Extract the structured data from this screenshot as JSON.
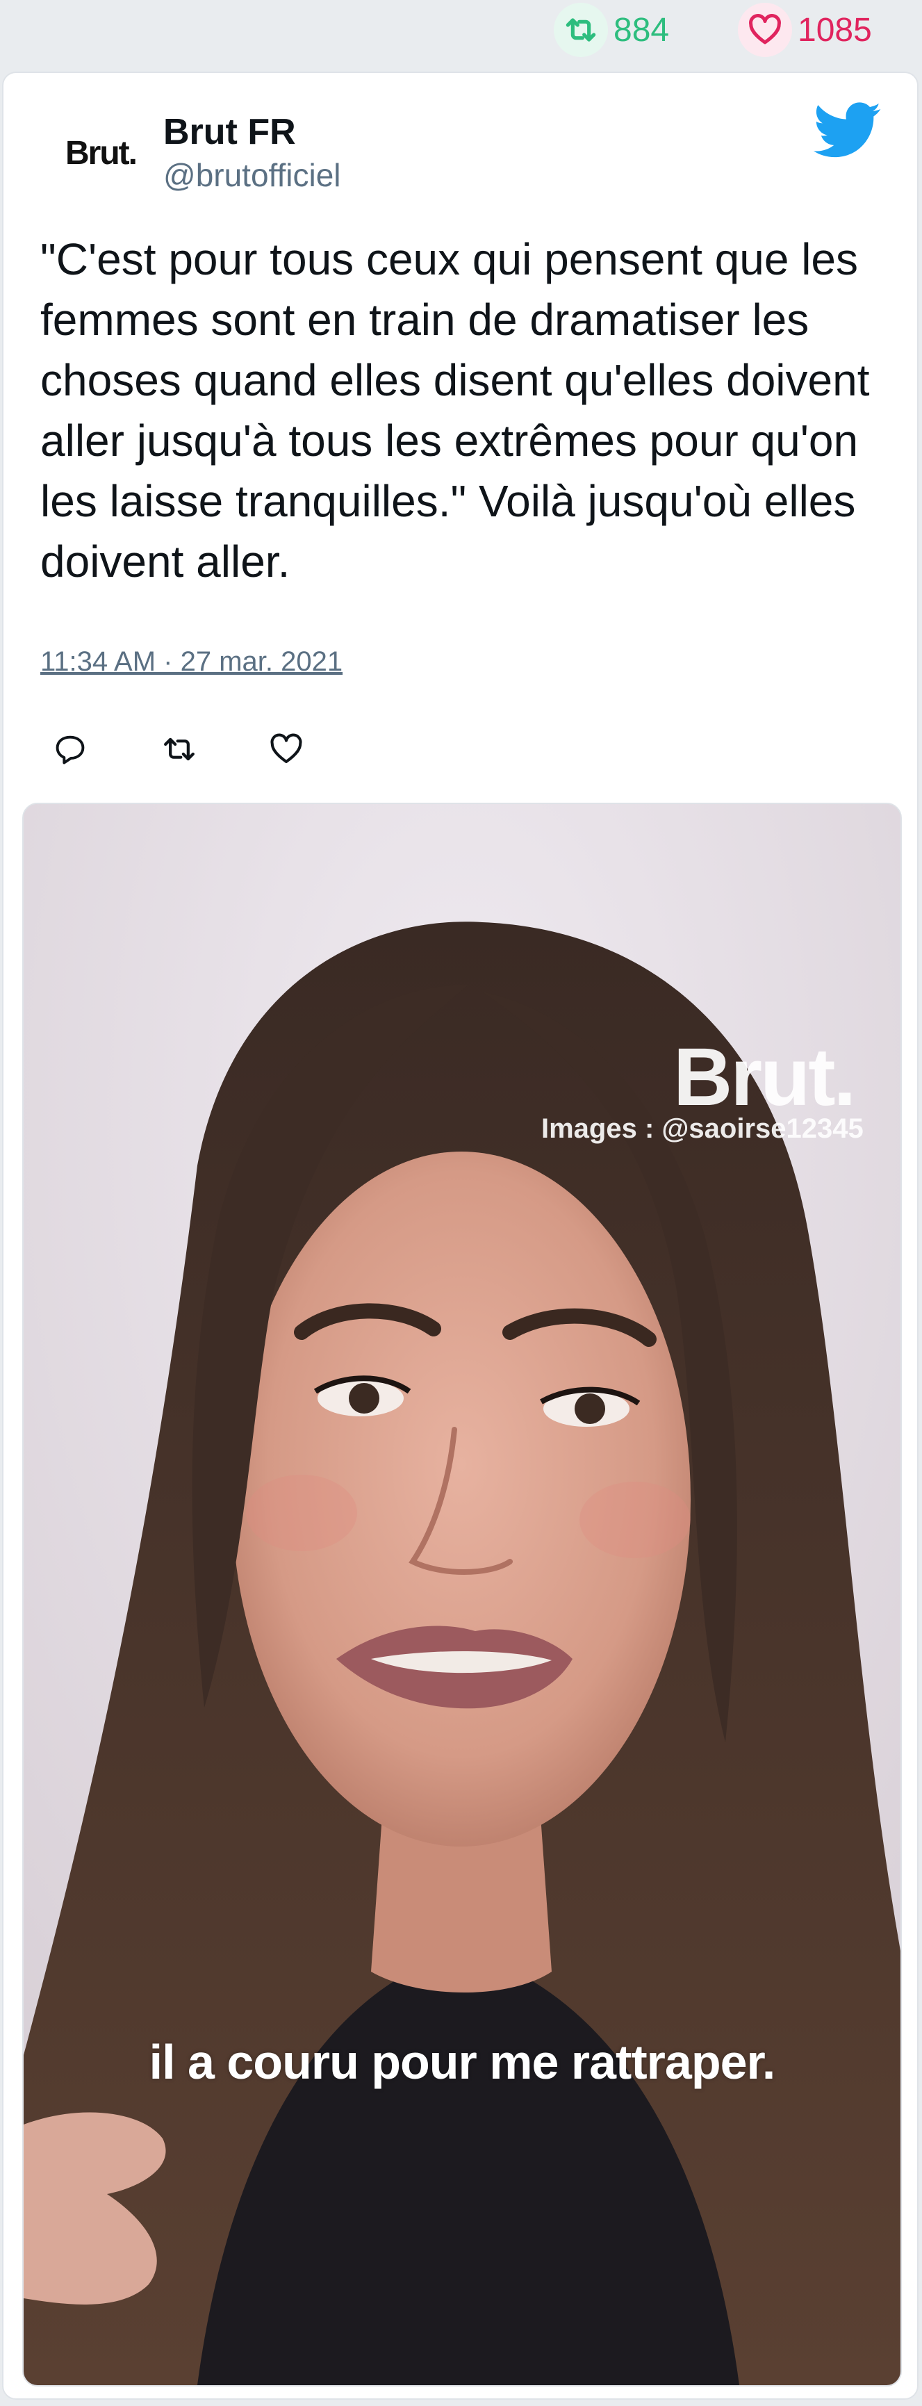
{
  "stats": {
    "retweets": "884",
    "likes": "1085"
  },
  "author": {
    "avatar_text": "Brut.",
    "name": "Brut FR",
    "handle": "@brutofficiel"
  },
  "tweet": {
    "text": "\"C'est pour tous ceux qui pensent que les femmes sont en train de dramatiser les choses quand elles disent qu'elles doivent aller jusqu'à tous les extrêmes pour qu'on les laisse tranquilles.\" Voilà jusqu'où elles doivent aller.",
    "timestamp": "11:34 AM · 27 mar. 2021"
  },
  "media": {
    "logo_text": "Brut.",
    "credit": "Images : @saoirse12345",
    "caption": "il a couru pour me rattraper."
  },
  "icons": {
    "retweet": "retweet-icon",
    "like": "heart-icon",
    "reply": "reply-icon",
    "brand": "twitter-bird-icon"
  },
  "colors": {
    "retweet": "#2dbd7e",
    "like": "#e0245e",
    "twitter_blue": "#1da1f2",
    "muted": "#5b7083"
  }
}
